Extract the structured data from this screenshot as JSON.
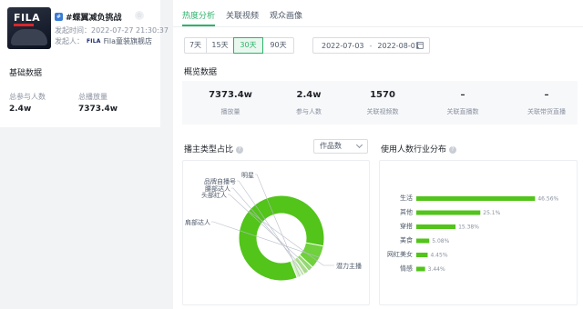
{
  "topic": {
    "logo_text": "FILA",
    "tag_icon": "#",
    "title": "#蝶翼减负挑战",
    "publish_time": "发起时间：2022-07-27 21:30:37",
    "initiator_label": "发起人：",
    "initiator_logo": "FILA",
    "initiator_name": "Fila童装旗舰店",
    "star_icon": "☆"
  },
  "basic": {
    "title": "基础数据",
    "participants_label": "总参与人数",
    "participants_value": "2.4w",
    "plays_label": "总播放量",
    "plays_value": "7373.4w"
  },
  "tabs": [
    {
      "label": "热度分析",
      "active": true
    },
    {
      "label": "关联视频",
      "active": false
    },
    {
      "label": "观众画像",
      "active": false
    }
  ],
  "ranges": [
    {
      "label": "7天",
      "active": false
    },
    {
      "label": "15天",
      "active": false
    },
    {
      "label": "30天",
      "active": true
    },
    {
      "label": "90天",
      "active": false
    }
  ],
  "date_range": {
    "start": "2022-07-03",
    "sep": "-",
    "end": "2022-08-01"
  },
  "overview": {
    "title": "概览数据",
    "items": [
      {
        "value": "7373.4w",
        "label": "播放量"
      },
      {
        "value": "2.4w",
        "label": "参与人数"
      },
      {
        "value": "1570",
        "label": "关联视频数"
      },
      {
        "value": "–",
        "label": "关联直播数"
      },
      {
        "value": "–",
        "label": "关联带货直播"
      }
    ]
  },
  "anchor_type": {
    "title": "播主类型占比",
    "help_icon": "?",
    "select_value": "作品数",
    "labels": [
      "明星",
      "品牌自播号",
      "腰部达人",
      "头部红人",
      "肩部达人",
      "潜力主播"
    ]
  },
  "industry": {
    "title": "使用人数行业分布",
    "help_icon": "?",
    "value_labels": [
      "46.56%",
      "25.1%",
      "15.38%",
      "5.08%",
      "4.45%",
      "3.44%"
    ]
  },
  "colors": {
    "accent": "#2bb36a",
    "bar": "#52c41a",
    "donut_main": "#52c41a"
  },
  "chart_data": [
    {
      "type": "pie",
      "title": "播主类型占比",
      "categories": [
        "潜力主播",
        "肩部达人",
        "头部红人",
        "腰部达人",
        "品牌自播号",
        "明星"
      ],
      "values": [
        84,
        9,
        2,
        2,
        1,
        2
      ]
    },
    {
      "type": "bar",
      "title": "使用人数行业分布",
      "categories": [
        "生活",
        "其他",
        "穿搭",
        "美食",
        "网红美女",
        "情感"
      ],
      "values": [
        46.56,
        25.1,
        15.38,
        5.08,
        4.45,
        3.44
      ],
      "unit": "%"
    }
  ]
}
